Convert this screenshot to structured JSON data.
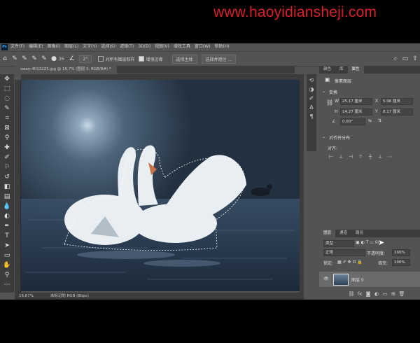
{
  "watermark": "www.haoyidiansheji.com",
  "menubar": {
    "logo": "Ps",
    "items": [
      "文件(F)",
      "编辑(E)",
      "图像(I)",
      "图层(L)",
      "文字(Y)",
      "选择(S)",
      "滤镜(T)",
      "3D(D)",
      "视图(V)",
      "增效工具",
      "窗口(W)",
      "帮助(H)"
    ]
  },
  "options_bar": {
    "brush_size": "35",
    "angle_value": "2°",
    "sample_all_layers": "对所有图层取样",
    "enhance_edge": "增强边缘",
    "select_subject": "选择主体",
    "select_and_mask": "选择并遮住 ..."
  },
  "document": {
    "tab_title": "swan-4013225.jpg @ 16.7% (图层 0, RGB/8#) *",
    "zoom": "16.67%",
    "status_text": "未标记的 RGB (8bpc)"
  },
  "properties_panel": {
    "tabs": [
      "颜色",
      "库",
      "属性"
    ],
    "active_tab": "属性",
    "layer_type": "像素图层",
    "transform_header": "变换",
    "w_label": "W",
    "w_value": "25.17 厘米",
    "x_label": "X",
    "x_value": "5.96 厘米",
    "h_label": "H",
    "h_value": "14.27 厘米",
    "y_label": "Y",
    "y_value": "8.17 厘米",
    "angle_value": "0.00°",
    "align_header": "对齐并分布",
    "align_label": "对齐:"
  },
  "layers_panel": {
    "tabs": [
      "图层",
      "通道",
      "路径"
    ],
    "active_tab": "图层",
    "kind_filter": "类型",
    "blend_mode": "正常",
    "opacity_label": "不透明度:",
    "opacity_value": "100%",
    "lock_label": "锁定:",
    "fill_label": "填充:",
    "fill_value": "100%",
    "layer_name": "图层 0"
  }
}
